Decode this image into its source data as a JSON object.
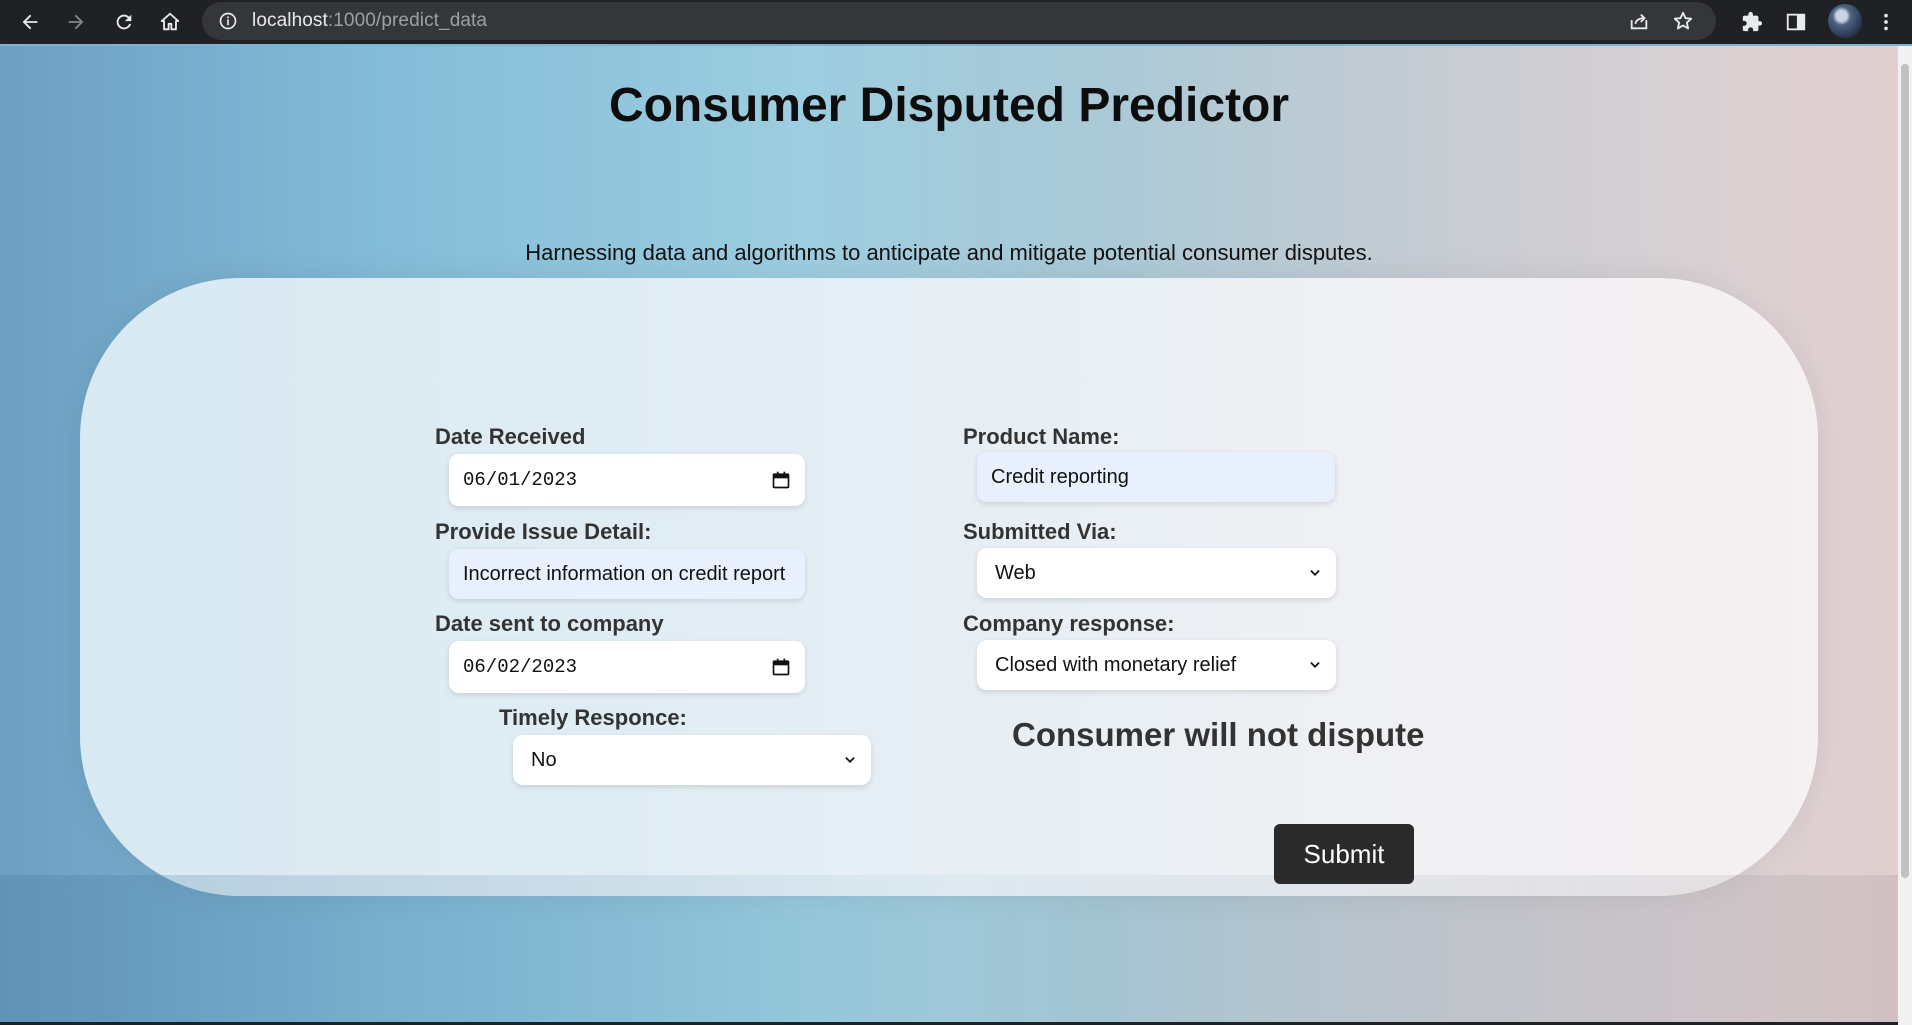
{
  "browser": {
    "url_host": "localhost",
    "url_path": ":1000/predict_data"
  },
  "page": {
    "title": "Consumer Disputed Predictor",
    "subtitle": "Harnessing data and algorithms to anticipate and mitigate potential consumer disputes."
  },
  "form": {
    "date_received": {
      "label": "Date Received",
      "value": "06/01/2023"
    },
    "issue_detail": {
      "label": "Provide Issue Detail:",
      "value": "Incorrect information on credit report"
    },
    "date_sent": {
      "label": "Date sent to company",
      "value": "06/02/2023"
    },
    "timely_response": {
      "label": "Timely Responce:",
      "value": "No"
    },
    "product_name": {
      "label": "Product Name:",
      "value": "Credit reporting"
    },
    "submitted_via": {
      "label": "Submitted Via:",
      "value": "Web"
    },
    "company_response": {
      "label": "Company response:",
      "value": "Closed with monetary relief"
    },
    "submit_label": "Submit"
  },
  "result": {
    "text": "Consumer will not dispute"
  },
  "icons": {
    "back": "arrow-left-icon",
    "forward": "arrow-right-icon",
    "reload": "reload-icon",
    "home": "home-icon",
    "info": "info-icon",
    "share": "share-icon",
    "star": "star-icon",
    "extensions": "puzzle-icon",
    "sidepanel": "side-panel-icon",
    "menu": "kebab-menu-icon",
    "calendar": "calendar-icon",
    "dropdown": "chevron-down-icon"
  },
  "colors": {
    "chrome_bg": "#202124",
    "omnibox_bg": "#35363a",
    "submit_bg": "#2a2a2a",
    "autofill_bg": "#e8f0fe"
  }
}
